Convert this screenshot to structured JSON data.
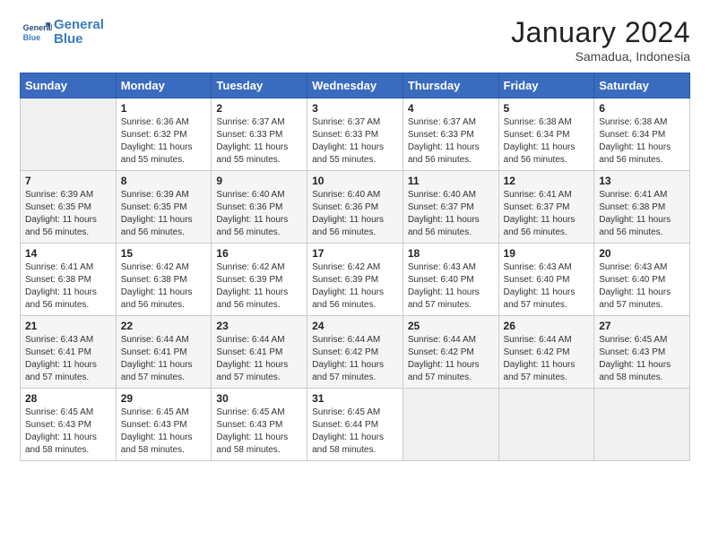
{
  "header": {
    "logo_line1": "General",
    "logo_line2": "Blue",
    "month": "January 2024",
    "location": "Samadua, Indonesia"
  },
  "days_of_week": [
    "Sunday",
    "Monday",
    "Tuesday",
    "Wednesday",
    "Thursday",
    "Friday",
    "Saturday"
  ],
  "weeks": [
    [
      {
        "day": "",
        "empty": true
      },
      {
        "day": "1",
        "sunrise": "6:36 AM",
        "sunset": "6:32 PM",
        "daylight": "11 hours and 55 minutes."
      },
      {
        "day": "2",
        "sunrise": "6:37 AM",
        "sunset": "6:33 PM",
        "daylight": "11 hours and 55 minutes."
      },
      {
        "day": "3",
        "sunrise": "6:37 AM",
        "sunset": "6:33 PM",
        "daylight": "11 hours and 55 minutes."
      },
      {
        "day": "4",
        "sunrise": "6:37 AM",
        "sunset": "6:33 PM",
        "daylight": "11 hours and 56 minutes."
      },
      {
        "day": "5",
        "sunrise": "6:38 AM",
        "sunset": "6:34 PM",
        "daylight": "11 hours and 56 minutes."
      },
      {
        "day": "6",
        "sunrise": "6:38 AM",
        "sunset": "6:34 PM",
        "daylight": "11 hours and 56 minutes."
      }
    ],
    [
      {
        "day": "7",
        "sunrise": "6:39 AM",
        "sunset": "6:35 PM",
        "daylight": "11 hours and 56 minutes."
      },
      {
        "day": "8",
        "sunrise": "6:39 AM",
        "sunset": "6:35 PM",
        "daylight": "11 hours and 56 minutes."
      },
      {
        "day": "9",
        "sunrise": "6:40 AM",
        "sunset": "6:36 PM",
        "daylight": "11 hours and 56 minutes."
      },
      {
        "day": "10",
        "sunrise": "6:40 AM",
        "sunset": "6:36 PM",
        "daylight": "11 hours and 56 minutes."
      },
      {
        "day": "11",
        "sunrise": "6:40 AM",
        "sunset": "6:37 PM",
        "daylight": "11 hours and 56 minutes."
      },
      {
        "day": "12",
        "sunrise": "6:41 AM",
        "sunset": "6:37 PM",
        "daylight": "11 hours and 56 minutes."
      },
      {
        "day": "13",
        "sunrise": "6:41 AM",
        "sunset": "6:38 PM",
        "daylight": "11 hours and 56 minutes."
      }
    ],
    [
      {
        "day": "14",
        "sunrise": "6:41 AM",
        "sunset": "6:38 PM",
        "daylight": "11 hours and 56 minutes."
      },
      {
        "day": "15",
        "sunrise": "6:42 AM",
        "sunset": "6:38 PM",
        "daylight": "11 hours and 56 minutes."
      },
      {
        "day": "16",
        "sunrise": "6:42 AM",
        "sunset": "6:39 PM",
        "daylight": "11 hours and 56 minutes."
      },
      {
        "day": "17",
        "sunrise": "6:42 AM",
        "sunset": "6:39 PM",
        "daylight": "11 hours and 56 minutes."
      },
      {
        "day": "18",
        "sunrise": "6:43 AM",
        "sunset": "6:40 PM",
        "daylight": "11 hours and 57 minutes."
      },
      {
        "day": "19",
        "sunrise": "6:43 AM",
        "sunset": "6:40 PM",
        "daylight": "11 hours and 57 minutes."
      },
      {
        "day": "20",
        "sunrise": "6:43 AM",
        "sunset": "6:40 PM",
        "daylight": "11 hours and 57 minutes."
      }
    ],
    [
      {
        "day": "21",
        "sunrise": "6:43 AM",
        "sunset": "6:41 PM",
        "daylight": "11 hours and 57 minutes."
      },
      {
        "day": "22",
        "sunrise": "6:44 AM",
        "sunset": "6:41 PM",
        "daylight": "11 hours and 57 minutes."
      },
      {
        "day": "23",
        "sunrise": "6:44 AM",
        "sunset": "6:41 PM",
        "daylight": "11 hours and 57 minutes."
      },
      {
        "day": "24",
        "sunrise": "6:44 AM",
        "sunset": "6:42 PM",
        "daylight": "11 hours and 57 minutes."
      },
      {
        "day": "25",
        "sunrise": "6:44 AM",
        "sunset": "6:42 PM",
        "daylight": "11 hours and 57 minutes."
      },
      {
        "day": "26",
        "sunrise": "6:44 AM",
        "sunset": "6:42 PM",
        "daylight": "11 hours and 57 minutes."
      },
      {
        "day": "27",
        "sunrise": "6:45 AM",
        "sunset": "6:43 PM",
        "daylight": "11 hours and 58 minutes."
      }
    ],
    [
      {
        "day": "28",
        "sunrise": "6:45 AM",
        "sunset": "6:43 PM",
        "daylight": "11 hours and 58 minutes."
      },
      {
        "day": "29",
        "sunrise": "6:45 AM",
        "sunset": "6:43 PM",
        "daylight": "11 hours and 58 minutes."
      },
      {
        "day": "30",
        "sunrise": "6:45 AM",
        "sunset": "6:43 PM",
        "daylight": "11 hours and 58 minutes."
      },
      {
        "day": "31",
        "sunrise": "6:45 AM",
        "sunset": "6:44 PM",
        "daylight": "11 hours and 58 minutes."
      },
      {
        "day": "",
        "empty": true
      },
      {
        "day": "",
        "empty": true
      },
      {
        "day": "",
        "empty": true
      }
    ]
  ]
}
